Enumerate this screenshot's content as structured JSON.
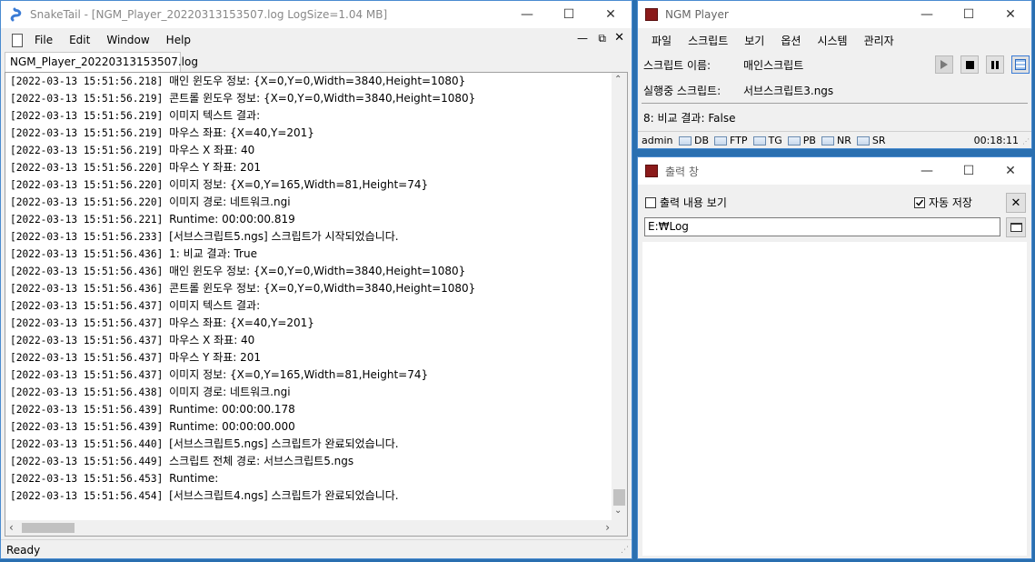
{
  "snaketail": {
    "title": "SnakeTail - [NGM_Player_20220313153507.log LogSize=1.04 MB]",
    "menu": [
      "File",
      "Edit",
      "Window",
      "Help"
    ],
    "tab": "NGM_Player_20220313153507.log",
    "status": "Ready",
    "lines": [
      {
        "ts": "[2022-03-13 15:51:56.218]",
        "msg": "매인 윈도우 정보: {X=0,Y=0,Width=3840,Height=1080}"
      },
      {
        "ts": "[2022-03-13 15:51:56.219]",
        "msg": "콘트롤 윈도우 정보: {X=0,Y=0,Width=3840,Height=1080}"
      },
      {
        "ts": "[2022-03-13 15:51:56.219]",
        "msg": "이미지 텍스트 결과:"
      },
      {
        "ts": "[2022-03-13 15:51:56.219]",
        "msg": "마우스 좌표: {X=40,Y=201}"
      },
      {
        "ts": "[2022-03-13 15:51:56.219]",
        "msg": "마우스 X 좌표: 40"
      },
      {
        "ts": "[2022-03-13 15:51:56.220]",
        "msg": "마우스 Y 좌표: 201"
      },
      {
        "ts": "[2022-03-13 15:51:56.220]",
        "msg": "이미지 정보: {X=0,Y=165,Width=81,Height=74}"
      },
      {
        "ts": "[2022-03-13 15:51:56.220]",
        "msg": "이미지 경로: 네트워크.ngi"
      },
      {
        "ts": "[2022-03-13 15:51:56.221]",
        "msg": "Runtime: 00:00:00.819"
      },
      {
        "ts": "[2022-03-13 15:51:56.233]",
        "msg": "[서브스크립트5.ngs] 스크립트가 시작되었습니다."
      },
      {
        "ts": "[2022-03-13 15:51:56.436]",
        "msg": "1: 비교 결과: True"
      },
      {
        "ts": "[2022-03-13 15:51:56.436]",
        "msg": "매인 윈도우 정보: {X=0,Y=0,Width=3840,Height=1080}"
      },
      {
        "ts": "[2022-03-13 15:51:56.436]",
        "msg": "콘트롤 윈도우 정보: {X=0,Y=0,Width=3840,Height=1080}"
      },
      {
        "ts": "[2022-03-13 15:51:56.437]",
        "msg": "이미지 텍스트 결과:"
      },
      {
        "ts": "[2022-03-13 15:51:56.437]",
        "msg": "마우스 좌표: {X=40,Y=201}"
      },
      {
        "ts": "[2022-03-13 15:51:56.437]",
        "msg": "마우스 X 좌표: 40"
      },
      {
        "ts": "[2022-03-13 15:51:56.437]",
        "msg": "마우스 Y 좌표: 201"
      },
      {
        "ts": "[2022-03-13 15:51:56.437]",
        "msg": "이미지 정보: {X=0,Y=165,Width=81,Height=74}"
      },
      {
        "ts": "[2022-03-13 15:51:56.438]",
        "msg": "이미지 경로: 네트워크.ngi"
      },
      {
        "ts": "[2022-03-13 15:51:56.439]",
        "msg": "Runtime: 00:00:00.178"
      },
      {
        "ts": "[2022-03-13 15:51:56.439]",
        "msg": "Runtime: 00:00:00.000"
      },
      {
        "ts": "[2022-03-13 15:51:56.440]",
        "msg": "[서브스크립트5.ngs] 스크립트가 완료되었습니다."
      },
      {
        "ts": "[2022-03-13 15:51:56.449]",
        "msg": "스크립트 전체 경로: 서브스크립트5.ngs"
      },
      {
        "ts": "[2022-03-13 15:51:56.453]",
        "msg": "Runtime:"
      },
      {
        "ts": "[2022-03-13 15:51:56.454]",
        "msg": "[서브스크립트4.ngs] 스크립트가 완료되었습니다."
      }
    ]
  },
  "player": {
    "title": "NGM Player",
    "menu": [
      "파일",
      "스크립트",
      "보기",
      "옵션",
      "시스템",
      "관리자"
    ],
    "script_name_label": "스크립트 이름:",
    "script_name_value": "매인스크립트",
    "running_label": "실행중 스크립트:",
    "running_value": "서브스크립트3.ngs",
    "result": "8: 비교 결과: False",
    "status_user": "admin",
    "status_items": [
      "DB",
      "FTP",
      "TG",
      "PB",
      "NR",
      "SR"
    ],
    "time": "00:18:11"
  },
  "output": {
    "title": "출력 창",
    "show_output_label": "출력 내용 보기",
    "auto_save_label": "자동 저장",
    "path_value": "E:₩Log"
  },
  "colors": {
    "desktop": "#2a6fb0",
    "accent": "#0078d7",
    "app_icon": "#8b1a1a"
  }
}
